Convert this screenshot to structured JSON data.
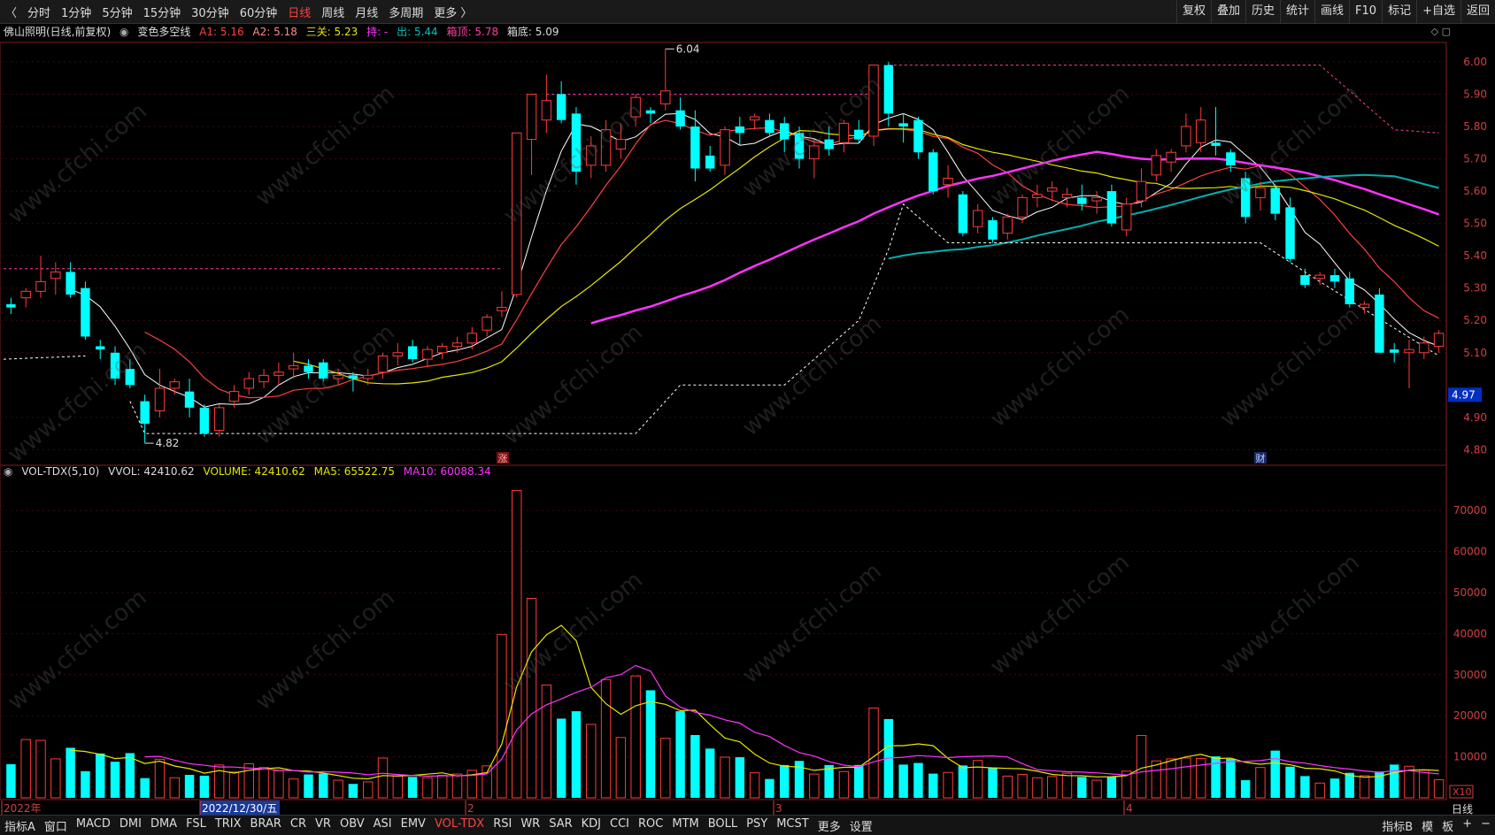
{
  "nav": {
    "back_icon": "back-arrow-icon",
    "periods": [
      "分时",
      "1分钟",
      "5分钟",
      "15分钟",
      "30分钟",
      "60分钟",
      "日线",
      "周线",
      "月线",
      "多周期",
      "更多 〉"
    ],
    "active_period": "日线",
    "right_tools": [
      "复权",
      "叠加",
      "历史",
      "统计",
      "画线",
      "F10",
      "标记",
      "+自选",
      "返回"
    ]
  },
  "legend": {
    "stock": "佛山照明(日线,前复权)",
    "indicator": "变色多空线",
    "a1": "A1: 5.16",
    "a2": "A2: 5.18",
    "sanguan": "三关: 5.23",
    "chi": "持: -",
    "chu": "出: 5.44",
    "xiangding": "箱顶: 5.78",
    "xiangdi": "箱底: 5.09"
  },
  "vol_legend": {
    "name": "VOL-TDX(5,10)",
    "vvol": "VVOL: 42410.62",
    "volume": "VOLUME: 42410.62",
    "ma5": "MA5: 65522.75",
    "ma10": "MA10: 60088.34"
  },
  "price_axis": [
    "6.00",
    "5.90",
    "5.80",
    "5.70",
    "5.60",
    "5.50",
    "5.40",
    "5.30",
    "5.20",
    "5.10",
    "4.97",
    "4.90",
    "4.80"
  ],
  "current_price": "4.97",
  "vol_axis": [
    "70000",
    "60000",
    "50000",
    "40000",
    "30000",
    "20000",
    "10000"
  ],
  "vol_unit": "X10",
  "annotations": {
    "high": "6.04",
    "low": "4.82",
    "zhang": "涨",
    "cai": "财"
  },
  "date_labels": [
    "2022年",
    "2022/12/30/五",
    "2",
    "3",
    "4"
  ],
  "right_label": "日线",
  "bottom_tabs": [
    "指标A",
    "窗口",
    "MACD",
    "DMI",
    "DMA",
    "FSL",
    "TRIX",
    "BRAR",
    "CR",
    "VR",
    "OBV",
    "ASI",
    "EMV",
    "VOL-TDX",
    "RSI",
    "WR",
    "SAR",
    "KDJ",
    "CCI",
    "ROC",
    "MTM",
    "BOLL",
    "PSY",
    "MCST",
    "更多",
    "设置"
  ],
  "active_tab": "VOL-TDX",
  "bottom_right": [
    "指标B",
    "模",
    "板",
    "+",
    "−"
  ],
  "watermark": "www.cfchi.com",
  "colors": {
    "up": "#ff3b3b",
    "down": "#00ffff",
    "ma5": "#ffffff",
    "ma10": "#ff4040",
    "ma20": "#e6e600",
    "ma60": "#ff33ff",
    "ma120": "#00b0b0",
    "bg": "#000000"
  },
  "chart_data": {
    "type": "candlestick",
    "ylim": [
      4.76,
      6.06
    ],
    "candles": [
      [
        5.25,
        5.27,
        5.22,
        5.24
      ],
      [
        5.27,
        5.3,
        5.24,
        5.29
      ],
      [
        5.29,
        5.4,
        5.27,
        5.32
      ],
      [
        5.33,
        5.38,
        5.28,
        5.35
      ],
      [
        5.35,
        5.38,
        5.27,
        5.28
      ],
      [
        5.3,
        5.32,
        5.14,
        5.15
      ],
      [
        5.12,
        5.14,
        5.08,
        5.11
      ],
      [
        5.1,
        5.12,
        5.0,
        5.02
      ],
      [
        5.05,
        5.08,
        4.99,
        5.0
      ],
      [
        4.95,
        4.97,
        4.82,
        4.88
      ],
      [
        4.92,
        5.05,
        4.9,
        4.99
      ],
      [
        4.99,
        5.02,
        4.97,
        5.01
      ],
      [
        4.98,
        5.02,
        4.9,
        4.93
      ],
      [
        4.93,
        4.94,
        4.84,
        4.85
      ],
      [
        4.86,
        4.94,
        4.84,
        4.93
      ],
      [
        4.95,
        5.0,
        4.93,
        4.98
      ],
      [
        4.99,
        5.04,
        4.97,
        5.02
      ],
      [
        5.01,
        5.05,
        4.99,
        5.03
      ],
      [
        5.03,
        5.07,
        5.0,
        5.04
      ],
      [
        5.05,
        5.1,
        5.02,
        5.06
      ],
      [
        5.06,
        5.08,
        5.02,
        5.04
      ],
      [
        5.07,
        5.08,
        5.01,
        5.02
      ],
      [
        5.02,
        5.05,
        5.0,
        5.03
      ],
      [
        5.03,
        5.04,
        4.98,
        5.02
      ],
      [
        5.02,
        5.05,
        5.0,
        5.03
      ],
      [
        5.04,
        5.1,
        5.02,
        5.09
      ],
      [
        5.09,
        5.13,
        5.06,
        5.1
      ],
      [
        5.12,
        5.14,
        5.07,
        5.08
      ],
      [
        5.08,
        5.12,
        5.06,
        5.11
      ],
      [
        5.1,
        5.13,
        5.08,
        5.12
      ],
      [
        5.12,
        5.15,
        5.1,
        5.13
      ],
      [
        5.13,
        5.18,
        5.11,
        5.16
      ],
      [
        5.17,
        5.22,
        5.15,
        5.21
      ],
      [
        5.23,
        5.29,
        5.21,
        5.24
      ],
      [
        5.28,
        5.78,
        5.27,
        5.78
      ],
      [
        5.76,
        5.9,
        5.65,
        5.9
      ],
      [
        5.82,
        5.96,
        5.78,
        5.88
      ],
      [
        5.9,
        5.94,
        5.81,
        5.82
      ],
      [
        5.84,
        5.86,
        5.62,
        5.66
      ],
      [
        5.68,
        5.77,
        5.64,
        5.74
      ],
      [
        5.68,
        5.82,
        5.66,
        5.79
      ],
      [
        5.73,
        5.81,
        5.7,
        5.76
      ],
      [
        5.83,
        5.9,
        5.8,
        5.89
      ],
      [
        5.85,
        5.86,
        5.81,
        5.84
      ],
      [
        5.87,
        6.04,
        5.85,
        5.91
      ],
      [
        5.85,
        5.89,
        5.79,
        5.8
      ],
      [
        5.8,
        5.85,
        5.63,
        5.67
      ],
      [
        5.71,
        5.74,
        5.66,
        5.67
      ],
      [
        5.68,
        5.8,
        5.65,
        5.79
      ],
      [
        5.8,
        5.83,
        5.74,
        5.78
      ],
      [
        5.82,
        5.84,
        5.79,
        5.83
      ],
      [
        5.82,
        5.84,
        5.77,
        5.78
      ],
      [
        5.81,
        5.83,
        5.72,
        5.76
      ],
      [
        5.78,
        5.8,
        5.67,
        5.7
      ],
      [
        5.7,
        5.76,
        5.64,
        5.74
      ],
      [
        5.76,
        5.8,
        5.71,
        5.73
      ],
      [
        5.75,
        5.82,
        5.72,
        5.81
      ],
      [
        5.79,
        5.82,
        5.75,
        5.76
      ],
      [
        5.77,
        5.99,
        5.74,
        5.99
      ],
      [
        5.99,
        6.0,
        5.8,
        5.84
      ],
      [
        5.81,
        5.84,
        5.75,
        5.8
      ],
      [
        5.82,
        5.83,
        5.7,
        5.72
      ],
      [
        5.72,
        5.73,
        5.59,
        5.6
      ],
      [
        5.62,
        5.68,
        5.58,
        5.64
      ],
      [
        5.59,
        5.6,
        5.46,
        5.47
      ],
      [
        5.49,
        5.56,
        5.47,
        5.54
      ],
      [
        5.51,
        5.52,
        5.44,
        5.45
      ],
      [
        5.47,
        5.53,
        5.45,
        5.52
      ],
      [
        5.52,
        5.59,
        5.5,
        5.58
      ],
      [
        5.58,
        5.62,
        5.55,
        5.59
      ],
      [
        5.6,
        5.63,
        5.57,
        5.61
      ],
      [
        5.58,
        5.61,
        5.55,
        5.59
      ],
      [
        5.58,
        5.62,
        5.54,
        5.56
      ],
      [
        5.57,
        5.6,
        5.53,
        5.58
      ],
      [
        5.6,
        5.62,
        5.49,
        5.5
      ],
      [
        5.48,
        5.58,
        5.46,
        5.56
      ],
      [
        5.57,
        5.67,
        5.55,
        5.63
      ],
      [
        5.65,
        5.73,
        5.63,
        5.71
      ],
      [
        5.69,
        5.73,
        5.66,
        5.72
      ],
      [
        5.74,
        5.84,
        5.72,
        5.8
      ],
      [
        5.75,
        5.86,
        5.72,
        5.82
      ],
      [
        5.75,
        5.86,
        5.71,
        5.74
      ],
      [
        5.72,
        5.73,
        5.66,
        5.68
      ],
      [
        5.64,
        5.66,
        5.5,
        5.52
      ],
      [
        5.58,
        5.63,
        5.54,
        5.61
      ],
      [
        5.61,
        5.62,
        5.51,
        5.53
      ],
      [
        5.55,
        5.58,
        5.38,
        5.39
      ],
      [
        5.34,
        5.36,
        5.3,
        5.31
      ],
      [
        5.33,
        5.35,
        5.31,
        5.34
      ],
      [
        5.34,
        5.36,
        5.3,
        5.32
      ],
      [
        5.33,
        5.35,
        5.24,
        5.25
      ],
      [
        5.24,
        5.26,
        5.22,
        5.25
      ],
      [
        5.28,
        5.3,
        5.1,
        5.1
      ],
      [
        5.11,
        5.13,
        5.07,
        5.1
      ],
      [
        5.1,
        5.14,
        4.99,
        5.11
      ],
      [
        5.1,
        5.15,
        5.08,
        5.13
      ],
      [
        5.12,
        5.17,
        5.1,
        5.16
      ]
    ],
    "volumes": [
      8200,
      14200,
      14000,
      9500,
      12200,
      6500,
      10800,
      8800,
      10900,
      4800,
      9400,
      4900,
      5600,
      5400,
      8000,
      6300,
      8300,
      7400,
      6600,
      4600,
      5700,
      5900,
      4300,
      3400,
      3900,
      9700,
      5300,
      5100,
      4900,
      5500,
      5800,
      6700,
      7800,
      39800,
      74900,
      48600,
      27500,
      19300,
      21100,
      17900,
      28800,
      14700,
      29700,
      26200,
      14500,
      21100,
      15300,
      12000,
      9900,
      9900,
      6100,
      4600,
      8000,
      9000,
      5800,
      8000,
      6400,
      8000,
      21900,
      19200,
      8100,
      8500,
      5900,
      6200,
      7900,
      9100,
      7400,
      5300,
      5700,
      4900,
      5200,
      6000,
      5100,
      4300,
      5100,
      6500,
      15200,
      9000,
      9500,
      9700,
      9600,
      10100,
      9500,
      4300,
      7400,
      11500,
      7600,
      5300,
      3600,
      4700,
      6100,
      5400,
      6400,
      8100,
      7700,
      6700,
      4400
    ],
    "ma5_vol": "MA5: 65522.75",
    "ma10_vol": "MA10: 60088.34"
  }
}
